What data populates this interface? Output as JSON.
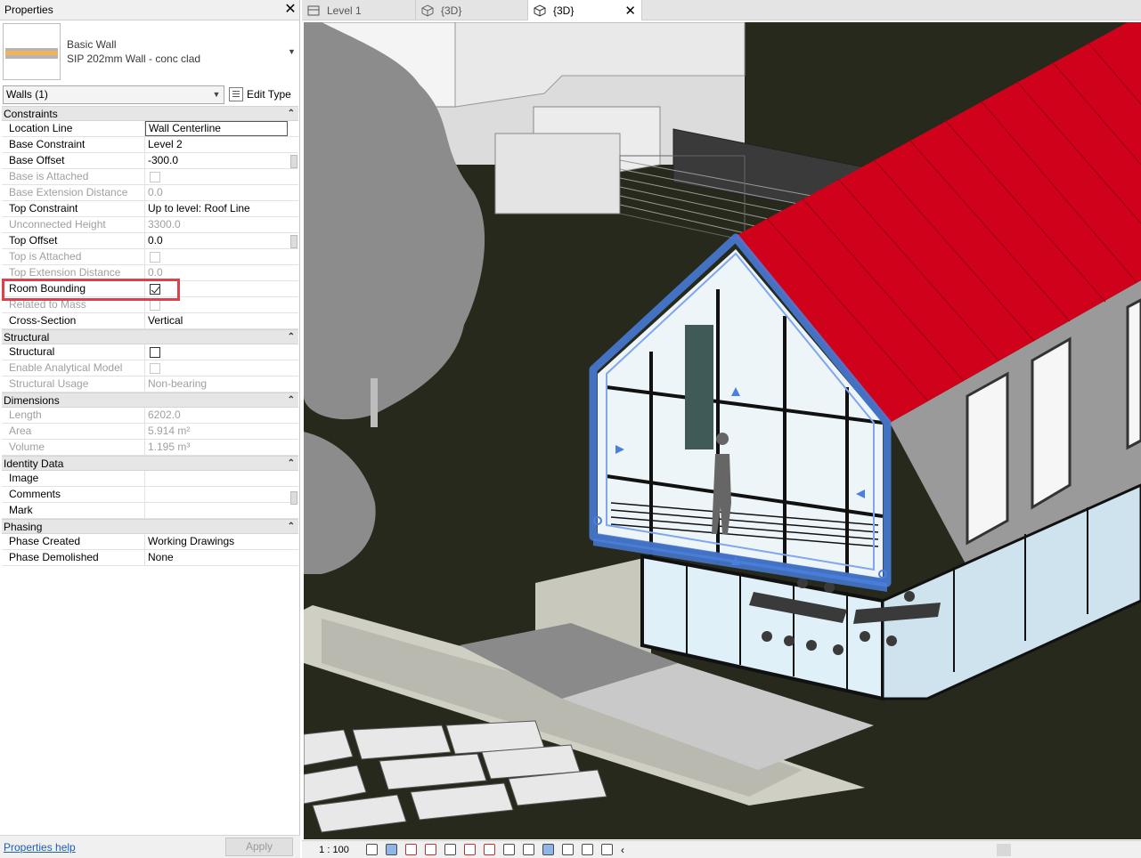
{
  "properties_panel": {
    "title": "Properties",
    "type_family": "Basic Wall",
    "type_name": "SIP 202mm Wall - conc clad",
    "filter": "Walls (1)",
    "edit_type_label": "Edit Type",
    "help_link": "Properties help",
    "apply_label": "Apply",
    "groups": [
      {
        "name": "Constraints",
        "rows": [
          {
            "name": "Location Line",
            "value": "Wall Centerline",
            "disabled": false,
            "editing": true
          },
          {
            "name": "Base Constraint",
            "value": "Level 2",
            "disabled": false
          },
          {
            "name": "Base Offset",
            "value": "-300.0",
            "disabled": false
          },
          {
            "name": "Base is Attached",
            "checkbox": false,
            "disabled": true
          },
          {
            "name": "Base Extension Distance",
            "value": "0.0",
            "disabled": true
          },
          {
            "name": "Top Constraint",
            "value": "Up to level: Roof Line",
            "disabled": false
          },
          {
            "name": "Unconnected Height",
            "value": "3300.0",
            "disabled": true
          },
          {
            "name": "Top Offset",
            "value": "0.0",
            "disabled": false
          },
          {
            "name": "Top is Attached",
            "checkbox": false,
            "disabled": true
          },
          {
            "name": "Top Extension Distance",
            "value": "0.0",
            "disabled": true
          },
          {
            "name": "Room Bounding",
            "checkbox": true,
            "disabled": false
          },
          {
            "name": "Related to Mass",
            "checkbox": false,
            "disabled": true
          },
          {
            "name": "Cross-Section",
            "value": "Vertical",
            "disabled": false
          }
        ]
      },
      {
        "name": "Structural",
        "rows": [
          {
            "name": "Structural",
            "checkbox": false,
            "disabled": false
          },
          {
            "name": "Enable Analytical Model",
            "checkbox": false,
            "disabled": true
          },
          {
            "name": "Structural Usage",
            "value": "Non-bearing",
            "disabled": true
          }
        ]
      },
      {
        "name": "Dimensions",
        "rows": [
          {
            "name": "Length",
            "value": "6202.0",
            "disabled": true
          },
          {
            "name": "Area",
            "value": "5.914 m²",
            "disabled": true
          },
          {
            "name": "Volume",
            "value": "1.195 m³",
            "disabled": true
          }
        ]
      },
      {
        "name": "Identity Data",
        "rows": [
          {
            "name": "Image",
            "value": "",
            "disabled": false
          },
          {
            "name": "Comments",
            "value": "",
            "disabled": false
          },
          {
            "name": "Mark",
            "value": "",
            "disabled": false
          }
        ]
      },
      {
        "name": "Phasing",
        "rows": [
          {
            "name": "Phase Created",
            "value": "Working Drawings",
            "disabled": false
          },
          {
            "name": "Phase Demolished",
            "value": "None",
            "disabled": false
          }
        ]
      }
    ]
  },
  "tabs": [
    {
      "label": "Level 1",
      "icon": "floor-plan-icon",
      "active": false
    },
    {
      "label": "{3D}",
      "icon": "3d-view-icon",
      "active": false
    },
    {
      "label": "{3D}",
      "icon": "3d-view-icon",
      "active": true
    }
  ],
  "view_control_bar": {
    "scale": "1 : 100",
    "icons": [
      "detail-level-icon",
      "visual-style-icon",
      "sun-path-icon",
      "shadows-icon",
      "render-icon",
      "crop-view-icon",
      "show-crop-icon",
      "lock-view-icon",
      "temp-hide-icon",
      "reveal-hidden-icon",
      "worksharing-icon",
      "analytical-model-icon",
      "highlight-displacement-icon",
      "collapse-icon"
    ]
  },
  "colors": {
    "roof": "#d0021b",
    "selection": "#4a7fe0",
    "ground": "#26291c",
    "highlight_box": "#e0404a"
  }
}
